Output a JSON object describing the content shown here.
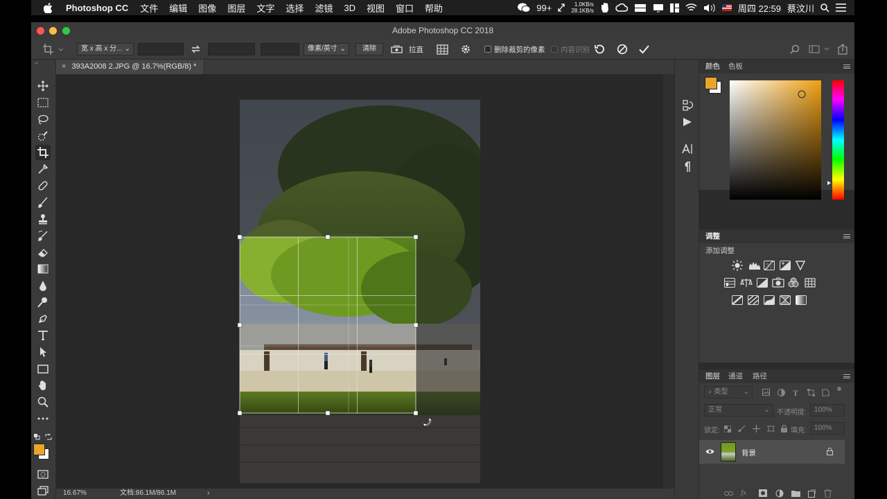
{
  "menubar": {
    "app_name": "Photoshop CC",
    "items": [
      "文件",
      "编辑",
      "图像",
      "图层",
      "文字",
      "选择",
      "滤镜",
      "3D",
      "视图",
      "窗口",
      "帮助"
    ],
    "wechat_badge": "99+",
    "net_up": "1.0KB/s",
    "net_down": "28.1KB/s",
    "clock": "周四 22:59",
    "user": "蔡汶川"
  },
  "window": {
    "title": "Adobe Photoshop CC 2018"
  },
  "options": {
    "ratio_preset": "宽 x 高 x 分...",
    "unit": "像素/英寸",
    "clear_label": "清除",
    "straighten_label": "拉直",
    "delete_cropped_label": "删除裁剪的像素",
    "content_aware_label": "内容识别"
  },
  "document": {
    "tab_title": "393A2008 2.JPG @ 16.7%(RGB/8) *",
    "zoom": "16.67%",
    "doc_size": "文档:86.1M/86.1M"
  },
  "colors": {
    "foreground": "#e8a52a",
    "background": "#ffffff",
    "picker_hue": "#f0a010"
  },
  "color_panel": {
    "tabs": [
      "颜色",
      "色板"
    ]
  },
  "adjustments_panel": {
    "title": "调整",
    "subtitle": "添加调整"
  },
  "layers_panel": {
    "tabs": [
      "图层",
      "通道",
      "路径"
    ],
    "filter_label": "类型",
    "blend_mode": "正常",
    "opacity_label": "不透明度:",
    "opacity_value": "100%",
    "lock_label": "锁定:",
    "fill_label": "填充:",
    "fill_value": "100%",
    "layers": [
      {
        "name": "背景",
        "visible": true,
        "locked": true
      }
    ]
  }
}
